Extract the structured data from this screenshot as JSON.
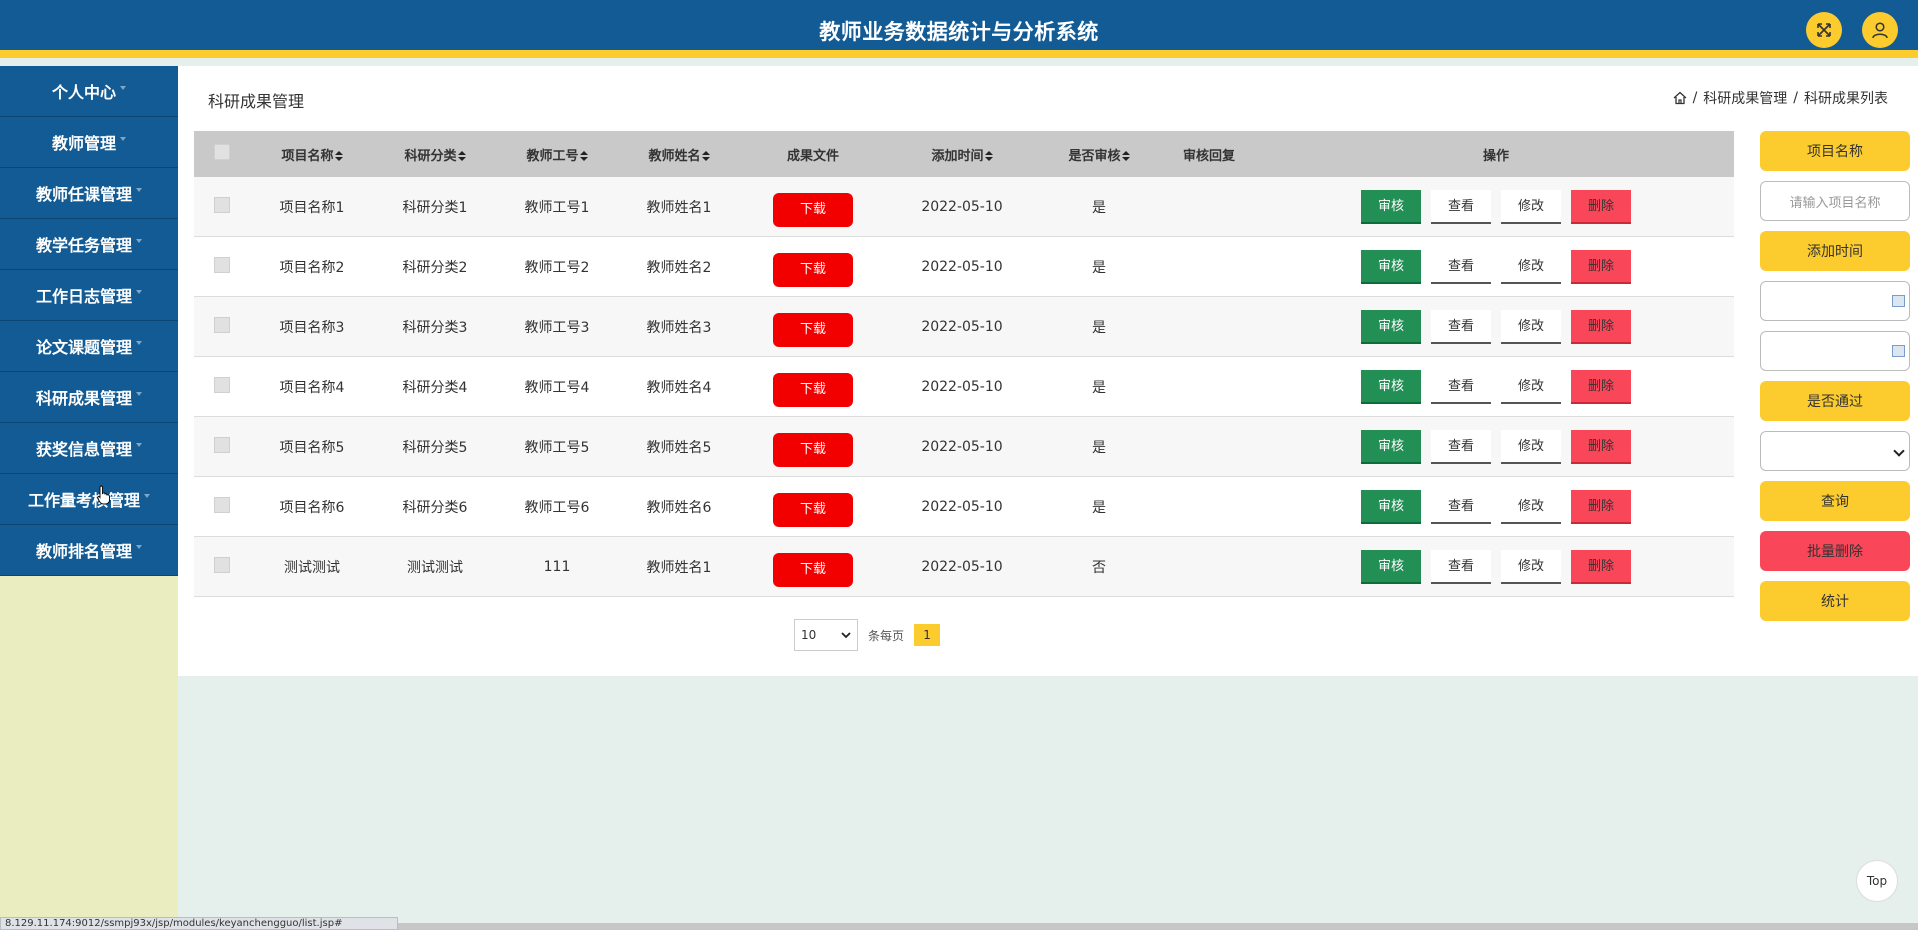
{
  "header": {
    "title": "教师业务数据统计与分析系统",
    "fullscreen_icon": "expand-icon",
    "user_icon": "user-icon"
  },
  "sidebar": {
    "items": [
      {
        "label": "个人中心"
      },
      {
        "label": "教师管理"
      },
      {
        "label": "教师任课管理"
      },
      {
        "label": "教学任务管理"
      },
      {
        "label": "工作日志管理"
      },
      {
        "label": "论文课题管理"
      },
      {
        "label": "科研成果管理"
      },
      {
        "label": "获奖信息管理"
      },
      {
        "label": "工作量考核管理"
      },
      {
        "label": "教师排名管理"
      }
    ]
  },
  "page": {
    "title": "科研成果管理",
    "breadcrumb": {
      "home_icon": "home-icon",
      "sep": "/",
      "level1": "科研成果管理",
      "level2": "科研成果列表"
    }
  },
  "table": {
    "headers": {
      "name": "项目名称",
      "category": "科研分类",
      "teacher_no": "教师工号",
      "teacher_name": "教师姓名",
      "file": "成果文件",
      "time": "添加时间",
      "passed": "是否审核",
      "reply": "审核回复",
      "ops": "操作"
    },
    "download_label": "下载",
    "op_labels": {
      "audit": "审核",
      "view": "查看",
      "edit": "修改",
      "delete": "删除"
    },
    "rows": [
      {
        "name": "项目名称1",
        "category": "科研分类1",
        "teacher_no": "教师工号1",
        "teacher_name": "教师姓名1",
        "time": "2022-05-10",
        "passed": "是",
        "reply": ""
      },
      {
        "name": "项目名称2",
        "category": "科研分类2",
        "teacher_no": "教师工号2",
        "teacher_name": "教师姓名2",
        "time": "2022-05-10",
        "passed": "是",
        "reply": ""
      },
      {
        "name": "项目名称3",
        "category": "科研分类3",
        "teacher_no": "教师工号3",
        "teacher_name": "教师姓名3",
        "time": "2022-05-10",
        "passed": "是",
        "reply": ""
      },
      {
        "name": "项目名称4",
        "category": "科研分类4",
        "teacher_no": "教师工号4",
        "teacher_name": "教师姓名4",
        "time": "2022-05-10",
        "passed": "是",
        "reply": ""
      },
      {
        "name": "项目名称5",
        "category": "科研分类5",
        "teacher_no": "教师工号5",
        "teacher_name": "教师姓名5",
        "time": "2022-05-10",
        "passed": "是",
        "reply": ""
      },
      {
        "name": "项目名称6",
        "category": "科研分类6",
        "teacher_no": "教师工号6",
        "teacher_name": "教师姓名6",
        "time": "2022-05-10",
        "passed": "是",
        "reply": ""
      },
      {
        "name": "测试测试",
        "category": "测试测试",
        "teacher_no": "111",
        "teacher_name": "教师姓名1",
        "time": "2022-05-10",
        "passed": "否",
        "reply": ""
      }
    ]
  },
  "pager": {
    "page_size": "10",
    "per_page_label": "条每页",
    "current_page": "1"
  },
  "search_panel": {
    "name_label": "项目名称",
    "name_placeholder": "请输入项目名称",
    "time_label": "添加时间",
    "pass_label": "是否通过",
    "query_button": "查询",
    "batch_delete_button": "批量删除",
    "stats_button": "统计"
  },
  "misc": {
    "top_button": "Top",
    "status_url": "8.129.11.174:9012/ssmpj93x/jsp/modules/keyanchengguo/list.jsp#"
  }
}
